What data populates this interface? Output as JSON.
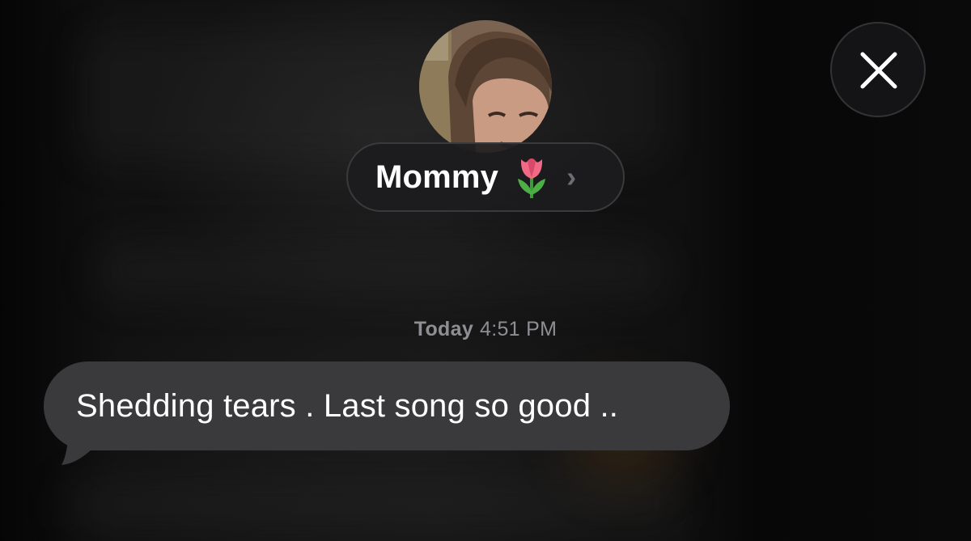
{
  "contact": {
    "name": "Mommy",
    "name_emoji": "tulip-icon",
    "chevron": "›"
  },
  "close_button": {
    "icon": "close-icon"
  },
  "conversation": {
    "timestamp_day": "Today",
    "timestamp_time": "4:51 PM",
    "messages": [
      {
        "direction": "incoming",
        "text": "Shedding tears . Last song so good .."
      }
    ]
  },
  "colors": {
    "background": "#000000",
    "bubble_incoming": "#3a3a3c",
    "text_primary": "#ffffff",
    "text_secondary": "#8e8e93",
    "pill_background": "#1c1c1e"
  }
}
